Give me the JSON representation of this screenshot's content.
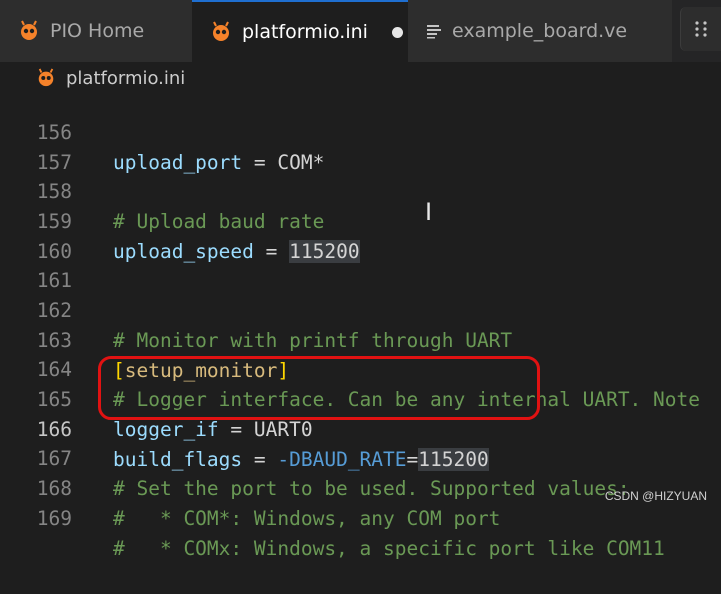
{
  "tabs": [
    {
      "label": "PIO Home",
      "icon": "alien-icon"
    },
    {
      "label": "platformio.ini",
      "icon": "alien-icon",
      "modified": true
    },
    {
      "label": "example_board.ve",
      "icon": "lines-icon"
    }
  ],
  "breadcrumb": {
    "file": "platformio.ini"
  },
  "lines": [
    {
      "n": "156",
      "key": "upload_port",
      "op": " = ",
      "val": "COM*"
    },
    {
      "n": "157"
    },
    {
      "n": "158",
      "comment": "# Upload baud rate"
    },
    {
      "n": "159",
      "key": "upload_speed",
      "op": " = ",
      "num": "115200"
    },
    {
      "n": "160"
    },
    {
      "n": "161"
    },
    {
      "n": "162",
      "comment": "# Monitor with printf through UART"
    },
    {
      "n": "163",
      "bracket_open": "[",
      "section": "setup_monitor",
      "bracket_close": "]"
    },
    {
      "n": "164",
      "comment": "# Logger interface. Can be any internal UART. Note"
    },
    {
      "n": "165",
      "key": "logger_if",
      "op": " = ",
      "val": "UART0"
    },
    {
      "n": "166",
      "key": "build_flags",
      "op": " = ",
      "flag": "-DBAUD_RATE",
      "eq": "=",
      "num": "115200"
    },
    {
      "n": "167",
      "comment": "# Set the port to be used. Supported values:"
    },
    {
      "n": "168",
      "comment": "#   * COM*: Windows, any COM port"
    },
    {
      "n": "169",
      "comment": "#   * COMx: Windows, a specific port like COM11"
    }
  ],
  "watermark": "CSDN @HIZYUAN",
  "colors": {
    "highlight_box": "#e11212",
    "active_tab_accent": "#1f6fd1"
  }
}
